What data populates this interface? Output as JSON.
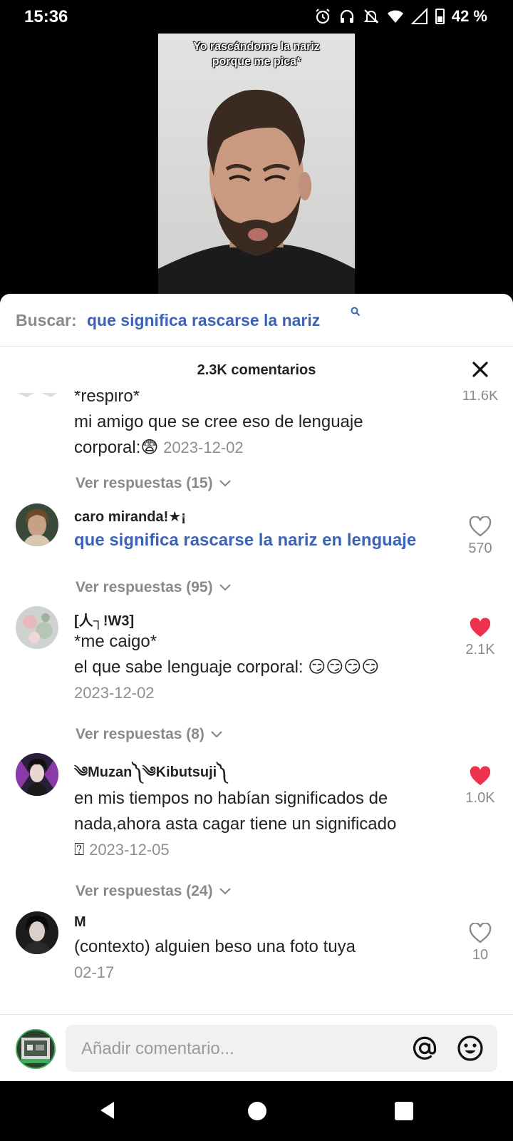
{
  "status": {
    "time": "15:36",
    "battery": "42 %"
  },
  "video": {
    "caption_line1": "Yo rascándome la nariz",
    "caption_line2": "porque me pica*"
  },
  "search": {
    "label": "Buscar:",
    "query": "que significa rascarse la nariz"
  },
  "comments_header": {
    "title": "2.3K comentarios"
  },
  "comments": [
    {
      "line1": "*respiro*",
      "line2": "mi amigo que se cree eso de lenguaje",
      "line3": "corporal:😨",
      "date": "2023-12-02",
      "likes": "11.6K",
      "replies": "Ver respuestas (15)"
    },
    {
      "name": "caro miranda!★¡",
      "text": "que significa rascarse la nariz en lenguaje",
      "likes": "570",
      "replies": "Ver respuestas (95)"
    },
    {
      "name": "[人┐!W3]",
      "line1": "*me caigo*",
      "line2": "el que sabe lenguaje corporal: 😏😏😏😏",
      "date": "2023-12-02",
      "likes": "2.1K",
      "replies": "Ver respuestas (8)"
    },
    {
      "name": "༄Muzan༽༄Kibutsuji༽",
      "line1": "en mis tiempos no habían significados de",
      "line2": "nada,ahora asta cagar tiene un significado",
      "glyph": "⍰",
      "date": "2023-12-05",
      "likes": "1.0K",
      "replies": "Ver respuestas (24)"
    },
    {
      "name": "M",
      "line1": "(contexto) alguien beso una foto tuya",
      "date": "02-17",
      "likes": "10"
    }
  ],
  "input": {
    "placeholder": "Añadir comentario..."
  },
  "colors": {
    "link_blue": "#3b63b7",
    "like_red": "#f0304f",
    "muted": "#8a8a8a"
  }
}
